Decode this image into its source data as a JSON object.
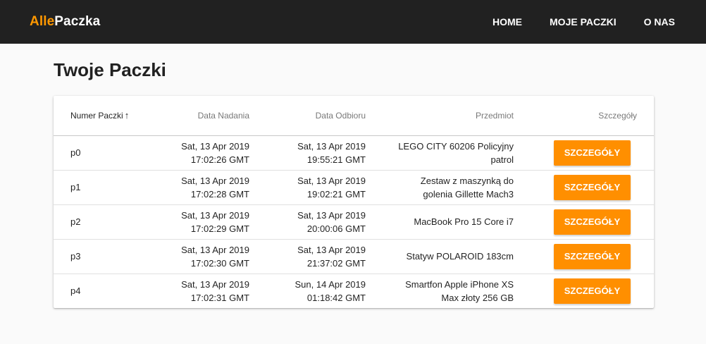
{
  "brand": {
    "accent": "Alle",
    "rest": "Paczka"
  },
  "nav": {
    "home": "HOME",
    "moje_paczki": "MOJE PACZKI",
    "o_nas": "O NAS"
  },
  "page_title": "Twoje Paczki",
  "table": {
    "headers": {
      "numer": "Numer Paczki",
      "sort_arrow": "↑",
      "data_nadania": "Data Nadania",
      "data_odbioru": "Data Odbioru",
      "przedmiot": "Przedmiot",
      "szczegoly": "Szczegóły"
    },
    "rows": [
      {
        "id": "p0",
        "sent_1": "Sat, 13 Apr 2019",
        "sent_2": "17:02:26 GMT",
        "recv_1": "Sat, 13 Apr 2019",
        "recv_2": "19:55:21 GMT",
        "item_1": "LEGO CITY 60206 Policyjny",
        "item_2": "patrol",
        "button": "SZCZEGÓŁY"
      },
      {
        "id": "p1",
        "sent_1": "Sat, 13 Apr 2019",
        "sent_2": "17:02:28 GMT",
        "recv_1": "Sat, 13 Apr 2019",
        "recv_2": "19:02:21 GMT",
        "item_1": "Zestaw z maszynką do",
        "item_2": "golenia Gillette Mach3",
        "button": "SZCZEGÓŁY"
      },
      {
        "id": "p2",
        "sent_1": "Sat, 13 Apr 2019",
        "sent_2": "17:02:29 GMT",
        "recv_1": "Sat, 13 Apr 2019",
        "recv_2": "20:00:06 GMT",
        "item_1": "MacBook Pro 15 Core i7",
        "item_2": "",
        "button": "SZCZEGÓŁY"
      },
      {
        "id": "p3",
        "sent_1": "Sat, 13 Apr 2019",
        "sent_2": "17:02:30 GMT",
        "recv_1": "Sat, 13 Apr 2019",
        "recv_2": "21:37:02 GMT",
        "item_1": "Statyw POLAROID 183cm",
        "item_2": "",
        "button": "SZCZEGÓŁY"
      },
      {
        "id": "p4",
        "sent_1": "Sat, 13 Apr 2019",
        "sent_2": "17:02:31 GMT",
        "recv_1": "Sun, 14 Apr 2019",
        "recv_2": "01:18:42 GMT",
        "item_1": "Smartfon Apple iPhone XS",
        "item_2": "Max złoty 256 GB",
        "button": "SZCZEGÓŁY"
      }
    ]
  },
  "colors": {
    "navbar": "#212121",
    "accent": "#ff9800",
    "button": "#ff8f00",
    "background": "#fafafa"
  }
}
